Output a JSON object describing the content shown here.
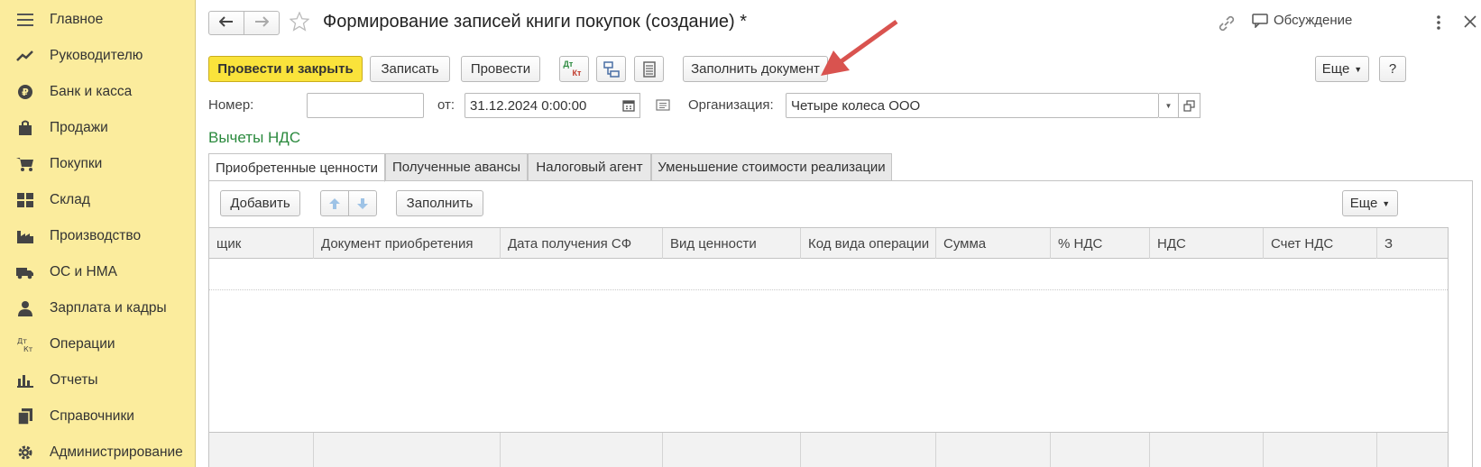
{
  "sidebar": {
    "items": [
      {
        "label": "Главное",
        "icon": "menu-icon"
      },
      {
        "label": "Руководителю",
        "icon": "trend-icon"
      },
      {
        "label": "Банк и касса",
        "icon": "ruble-icon"
      },
      {
        "label": "Продажи",
        "icon": "bag-icon"
      },
      {
        "label": "Покупки",
        "icon": "cart-icon"
      },
      {
        "label": "Склад",
        "icon": "warehouse-icon"
      },
      {
        "label": "Производство",
        "icon": "factory-icon"
      },
      {
        "label": "ОС и НМА",
        "icon": "truck-icon"
      },
      {
        "label": "Зарплата и кадры",
        "icon": "person-icon"
      },
      {
        "label": "Операции",
        "icon": "dt-kt-icon"
      },
      {
        "label": "Отчеты",
        "icon": "bar-chart-icon"
      },
      {
        "label": "Справочники",
        "icon": "books-icon"
      },
      {
        "label": "Администрирование",
        "icon": "gear-icon"
      }
    ]
  },
  "header": {
    "title": "Формирование записей книги покупок (создание) *",
    "discussion": "Обсуждение"
  },
  "toolbar": {
    "post_close": "Провести и закрыть",
    "save": "Записать",
    "post": "Провести",
    "dt_label": "Дт",
    "kt_label": "Кт",
    "fill_document": "Заполнить документ",
    "more": "Еще",
    "help": "?"
  },
  "form": {
    "number_label": "Номер:",
    "number_value": "",
    "date_label": "от:",
    "date_value": "31.12.2024  0:00:00",
    "org_label": "Организация:",
    "org_value": "Четыре колеса ООО"
  },
  "section_title": "Вычеты НДС",
  "tabs": [
    {
      "label": "Приобретенные ценности",
      "active": true
    },
    {
      "label": "Полученные авансы",
      "active": false
    },
    {
      "label": "Налоговый агент",
      "active": false
    },
    {
      "label": "Уменьшение стоимости реализации",
      "active": false
    }
  ],
  "table_toolbar": {
    "add": "Добавить",
    "fill": "Заполнить",
    "more": "Еще"
  },
  "table": {
    "columns": [
      "щик",
      "Документ приобретения",
      "Дата получения СФ",
      "Вид ценности",
      "Код вида операции",
      "Сумма",
      "% НДС",
      "НДС",
      "Счет НДС",
      "З"
    ]
  },
  "colors": {
    "sidebar_bg": "#fbec9d",
    "primary_button": "#fae33b",
    "section_title": "#2b8a3e",
    "annotation_arrow": "#d9534f"
  }
}
